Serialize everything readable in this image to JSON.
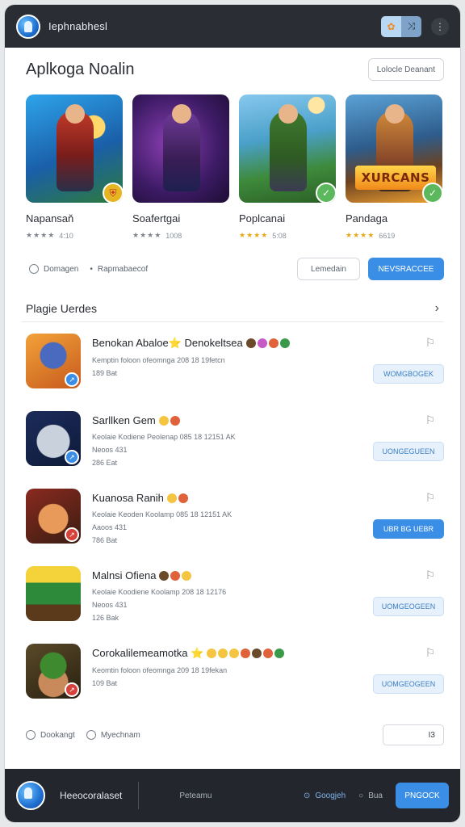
{
  "topbar": {
    "app_title": "Iephnabhesl",
    "icon_a": "sun-icon",
    "icon_b": "shuffle-icon",
    "menu_icon": "more-icon"
  },
  "header": {
    "title": "Aplkoga Noalin",
    "action_label": "Lolocle Deanant"
  },
  "featured": [
    {
      "name": "Napansaň",
      "stars": "★★★★",
      "rating": "4:10",
      "style": "grey",
      "badge": "red",
      "banner": ""
    },
    {
      "name": "Soafertgai",
      "stars": "★★★★",
      "rating": "1008",
      "style": "grey",
      "badge": "",
      "banner": ""
    },
    {
      "name": "Poplcanai",
      "stars": "★★★★",
      "rating": "5:08",
      "style": "gold",
      "badge": "green",
      "banner": ""
    },
    {
      "name": "Pandaga",
      "stars": "★★★★",
      "rating": "6619",
      "style": "gold",
      "badge": "green",
      "banner": "XURCANS"
    }
  ],
  "filters": {
    "left_label": "Domagen",
    "middle_label": "Rapmabaecof",
    "secondary_button": "Lemedain",
    "primary_button": "NEVSRACCEE"
  },
  "list": {
    "title": "Plagie Uerdes",
    "items": [
      {
        "name": "Benokan Abaloe⭐ Denokeltsea",
        "line1": "Kemptin foloon ofeomnga 208 18 19fetcn",
        "line2": "",
        "meta": "189 Bat",
        "button": "WOMGBOGEK",
        "active": false,
        "badge": "blue"
      },
      {
        "name": "Sarllken Gem",
        "line1": "Keolaie Kodiene Peolenap 085 18 12151 AK",
        "line2": "Neoos 431",
        "meta": "286 Eat",
        "button": "UONGEGUEEN",
        "active": false,
        "badge": "blue"
      },
      {
        "name": "Kuanosa Ranih",
        "line1": "Keolaie Keoden Koolamp 085 18 12151 AK",
        "line2": "Aaoos 431",
        "meta": "786 Bat",
        "button": "UBR BG UEBR",
        "active": true,
        "badge": "red"
      },
      {
        "name": "Malnsi Ofiena",
        "line1": "Keolaie Koodiene Koolamp 208 18 12176",
        "line2": "Neoos 431",
        "meta": "126 Bak",
        "button": "UOMGEOGEEN",
        "active": false,
        "badge": ""
      },
      {
        "name": "Corokalilemeamotka ⭐",
        "line1": "Keomtin foloon ofeomnga 209 18 19fekan",
        "line2": "",
        "meta": "109 Bat",
        "button": "UOMGEOGEEN",
        "active": false,
        "badge": "red"
      }
    ]
  },
  "bottom": {
    "left_label": "Dookangt",
    "right_label": "Myechnam",
    "page_value": "I3"
  },
  "footer": {
    "title": "Heeocoralaset",
    "link": "Peteamu",
    "nav1": "Googjeh",
    "nav2": "Bua",
    "button": "PNGOCK"
  },
  "colors": {
    "accent": "#3b8ee6",
    "topbar": "#2a2e34",
    "footer": "#23272d"
  }
}
